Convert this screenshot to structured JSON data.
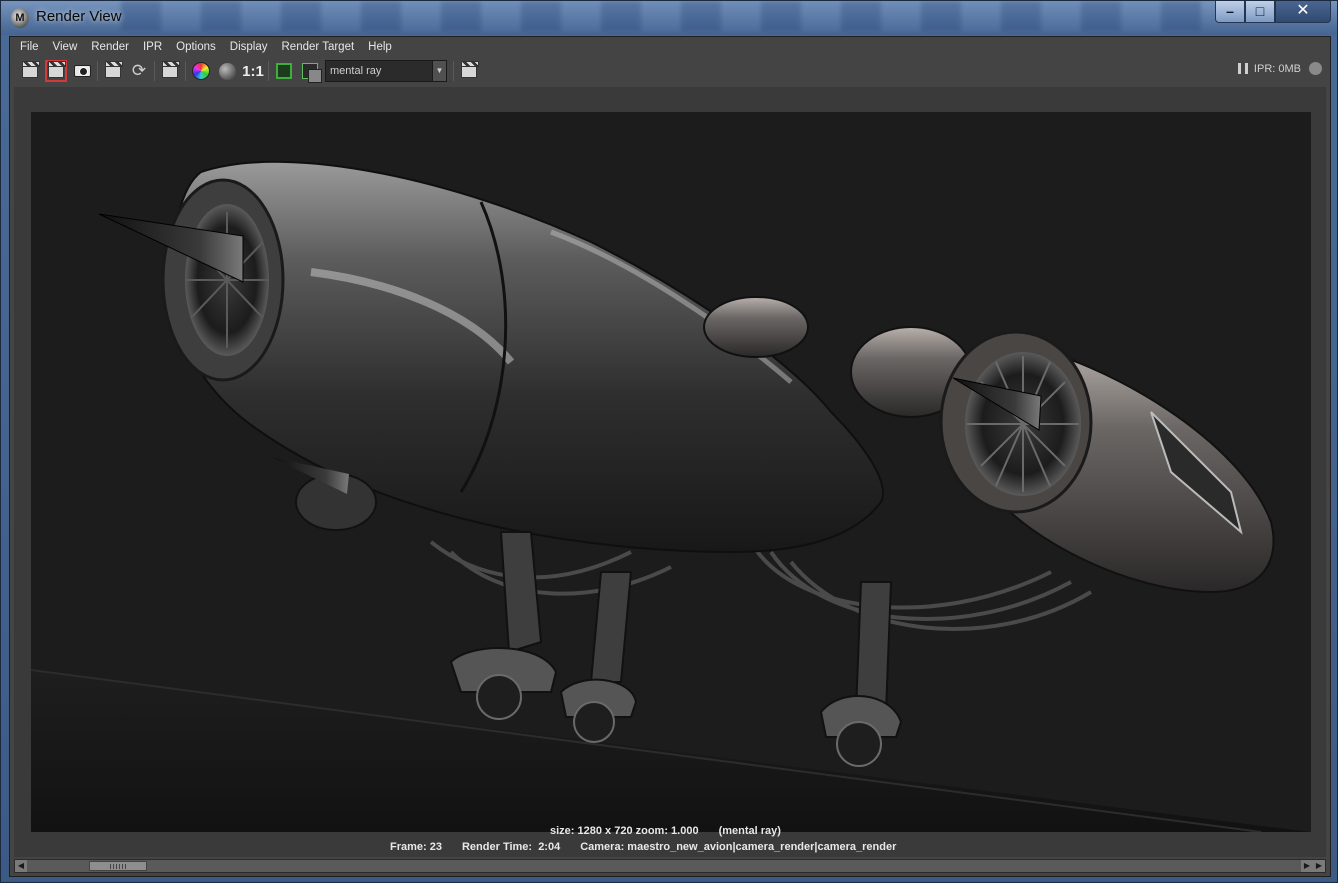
{
  "window": {
    "title": "Render View",
    "app_icon": "maya-icon"
  },
  "menu": [
    "File",
    "View",
    "Render",
    "IPR",
    "Options",
    "Display",
    "Render Target",
    "Help"
  ],
  "toolbar": {
    "ratio_label": "1:1",
    "renderer": "mental ray",
    "ipr_status": "IPR: 0MB"
  },
  "render_info": {
    "size_line": "size: 1280 x 720 zoom: 1.000",
    "renderer_tag": "(mental ray)",
    "frame": "Frame: 23",
    "render_time": "Render Time:  2:04",
    "camera": "Camera: maestro_new_avion|camera_render|camera_render"
  },
  "colors": {
    "panel": "#444444",
    "canvas": "#1c1c1c",
    "accent_red": "#d23a3a",
    "accent_green": "#3fae3f"
  }
}
